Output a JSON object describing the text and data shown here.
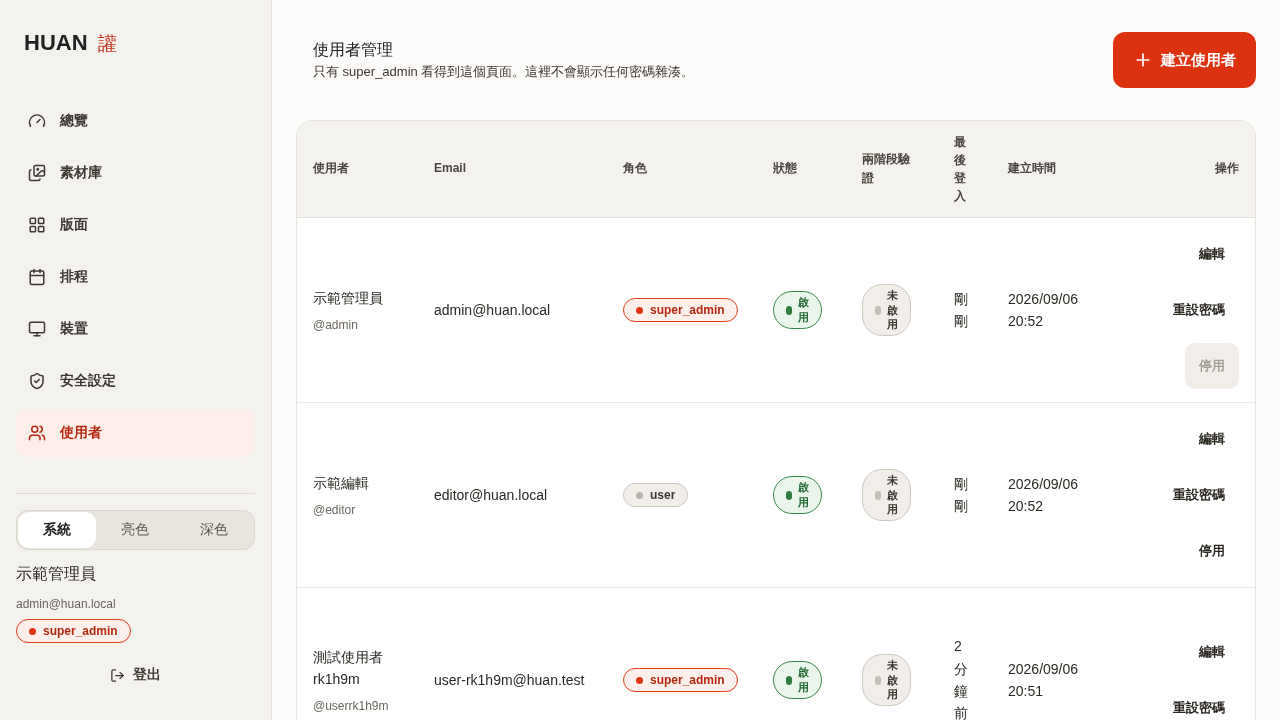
{
  "sidebar": {
    "logo": {
      "text": "HUAN",
      "mark": "讙"
    },
    "nav": [
      {
        "label": "總覽",
        "selected": false
      },
      {
        "label": "素材庫",
        "selected": false
      },
      {
        "label": "版面",
        "selected": false
      },
      {
        "label": "排程",
        "selected": false
      },
      {
        "label": "裝置",
        "selected": false
      },
      {
        "label": "安全設定",
        "selected": false
      },
      {
        "label": "使用者",
        "selected": true
      }
    ],
    "theme_options": [
      {
        "label": "系統",
        "selected": true
      },
      {
        "label": "亮色",
        "selected": false
      },
      {
        "label": "深色",
        "selected": false
      }
    ],
    "user": {
      "name": "示範管理員",
      "email": "admin@huan.local",
      "role": {
        "label": "super_admin",
        "kind": "super_admin"
      }
    },
    "logout": "登出"
  },
  "header": {
    "title": "使用者管理",
    "subtitle": "只有 super_admin 看得到這個頁面。這裡不會顯示任何密碼雜湊。",
    "create_button": "建立使用者"
  },
  "table": {
    "columns": [
      "使用者",
      "Email",
      "角色",
      "狀態",
      "兩階段驗證",
      "最後登入",
      "建立時間",
      "操作"
    ],
    "rows": [
      {
        "name": "示範管理員",
        "handle": "@admin",
        "email": "admin@huan.local",
        "role": {
          "label": "super_admin",
          "kind": "super_admin"
        },
        "status": {
          "label": "啟用",
          "on": true
        },
        "two_factor": {
          "label": "未啟用",
          "on": false
        },
        "last_login": "剛剛",
        "created": "2026/09/06 20:52",
        "actions": [
          {
            "label": "編輯",
            "disabled": false
          },
          {
            "label": "重設密碼",
            "disabled": false
          },
          {
            "label": "停用",
            "disabled": true
          }
        ]
      },
      {
        "name": "示範編輯",
        "handle": "@editor",
        "email": "editor@huan.local",
        "role": {
          "label": "user",
          "kind": "user"
        },
        "status": {
          "label": "啟用",
          "on": true
        },
        "two_factor": {
          "label": "未啟用",
          "on": false
        },
        "last_login": "剛剛",
        "created": "2026/09/06 20:52",
        "actions": [
          {
            "label": "編輯",
            "disabled": false
          },
          {
            "label": "重設密碼",
            "disabled": false
          },
          {
            "label": "停用",
            "disabled": false
          }
        ]
      },
      {
        "name": "測試使用者 rk1h9m",
        "handle": "@userrk1h9m",
        "email": "user-rk1h9m@huan.test",
        "role": {
          "label": "super_admin",
          "kind": "super_admin"
        },
        "status": {
          "label": "啟用",
          "on": true
        },
        "two_factor": {
          "label": "未啟用",
          "on": false
        },
        "last_login": "2分鐘前",
        "created": "2026/09/06 20:51",
        "actions": [
          {
            "label": "編輯",
            "disabled": false
          },
          {
            "label": "重設密碼",
            "disabled": false
          }
        ]
      }
    ]
  }
}
